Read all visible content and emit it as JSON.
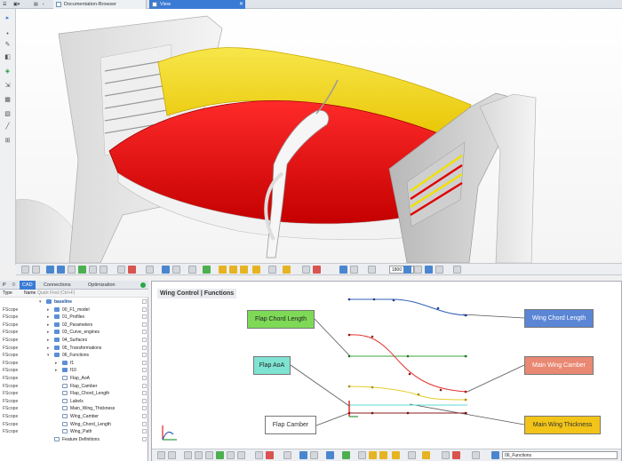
{
  "tabs": {
    "documents": "Documentation-Browser",
    "view": "View"
  },
  "view_toolbar": {
    "zoom_value": "1800"
  },
  "left_panel": {
    "tabs": {
      "p": "P",
      "cad": "CAD",
      "connections": "Connections",
      "optimization": "Optimization"
    },
    "columns": {
      "type": "Type",
      "name": "Name",
      "quick_find": "Quick Find (Ctrl+F)"
    },
    "tree": [
      {
        "type": "",
        "name": "baseline",
        "depth": 0,
        "bold": true,
        "leaf": false
      },
      {
        "type": "FScope",
        "name": "00_F1_model",
        "depth": 1,
        "leaf": false
      },
      {
        "type": "FScope",
        "name": "01_Profiles",
        "depth": 1,
        "leaf": false
      },
      {
        "type": "FScope",
        "name": "02_Parameters",
        "depth": 1,
        "leaf": false
      },
      {
        "type": "FScope",
        "name": "03_Curve_engines",
        "depth": 1,
        "leaf": false
      },
      {
        "type": "FScope",
        "name": "04_Surfaces",
        "depth": 1,
        "leaf": false
      },
      {
        "type": "FScope",
        "name": "05_Transformations",
        "depth": 1,
        "leaf": false
      },
      {
        "type": "FScope",
        "name": "06_Functions",
        "depth": 1,
        "leaf": false
      },
      {
        "type": "FScope",
        "name": "f1",
        "depth": 2,
        "leaf": false
      },
      {
        "type": "FScope",
        "name": "f10",
        "depth": 2,
        "leaf": false
      },
      {
        "type": "FScope",
        "name": "Flap_AoA",
        "depth": 2,
        "leaf": true
      },
      {
        "type": "FScope",
        "name": "Flap_Camber",
        "depth": 2,
        "leaf": true
      },
      {
        "type": "FScope",
        "name": "Flap_Chord_Length",
        "depth": 2,
        "leaf": true
      },
      {
        "type": "FScope",
        "name": "Labels",
        "depth": 2,
        "leaf": true
      },
      {
        "type": "FScope",
        "name": "Main_Wing_Thickness",
        "depth": 2,
        "leaf": true
      },
      {
        "type": "FScope",
        "name": "Wing_Camber",
        "depth": 2,
        "leaf": true
      },
      {
        "type": "FScope",
        "name": "Wing_Chord_Length",
        "depth": 2,
        "leaf": true
      },
      {
        "type": "FScope",
        "name": "Wing_Path",
        "depth": 2,
        "leaf": true
      },
      {
        "type": "",
        "name": "Feature Definitions",
        "depth": 1,
        "leaf": true
      }
    ]
  },
  "functions_panel": {
    "title": "Wing Control | Functions",
    "boxes": {
      "flap_chord_length": "Flap Chord Length",
      "flap_aoa": "Flap AoA",
      "flap_camber": "Flap Camber",
      "wing_chord_length": "Wing Chord Length",
      "main_wing_camber": "Main Wing Camber",
      "main_wing_thickness": "Main Wing Thickness"
    },
    "combo_value": "06_Functions"
  },
  "colors": {
    "accent": "#3a7bd5",
    "wing_yellow": "#f2d400",
    "wing_red": "#e00000",
    "curve_blue": "#2f5fb3",
    "curve_green": "#3da33d",
    "curve_red": "#e0302a",
    "curve_yellow": "#e8cc2a",
    "curve_cyan": "#5fd8d0",
    "curve_darkred": "#8a1e1e"
  },
  "icons": {
    "left_toolbar": [
      "selection-icon",
      "point-icon",
      "pencil-icon",
      "surface-icon",
      "move-icon",
      "import-icon",
      "spreadsheet-icon",
      "volume-icon",
      "line-icon",
      "measure-icon"
    ]
  }
}
